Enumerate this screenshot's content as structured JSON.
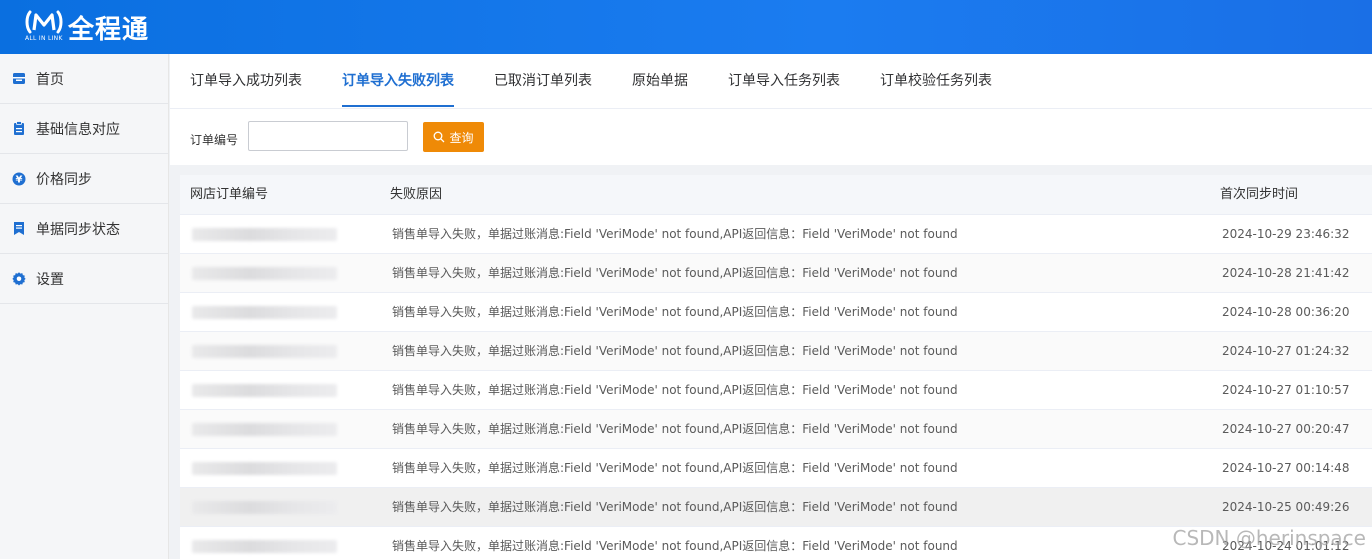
{
  "app": {
    "logo_text": "全程通",
    "logo_subtext": "ALL IN LINK"
  },
  "sidebar": {
    "items": [
      {
        "label": "首页",
        "icon": "inbox-icon"
      },
      {
        "label": "基础信息对应",
        "icon": "clipboard-icon"
      },
      {
        "label": "价格同步",
        "icon": "yen-icon"
      },
      {
        "label": "单据同步状态",
        "icon": "bookmark-icon"
      },
      {
        "label": "设置",
        "icon": "gear-icon"
      }
    ]
  },
  "tabs": [
    {
      "label": "订单导入成功列表",
      "active": false
    },
    {
      "label": "订单导入失败列表",
      "active": true
    },
    {
      "label": "已取消订单列表",
      "active": false
    },
    {
      "label": "原始单据",
      "active": false
    },
    {
      "label": "订单导入任务列表",
      "active": false
    },
    {
      "label": "订单校验任务列表",
      "active": false
    }
  ],
  "filter": {
    "order_no_label": "订单编号",
    "order_no_value": "",
    "search_label": "查询"
  },
  "table": {
    "columns": [
      "网店订单编号",
      "失败原因",
      "首次同步时间"
    ],
    "rows": [
      {
        "reason": "销售单导入失败，单据过账消息:Field 'VeriMode' not found,API返回信息：Field 'VeriMode' not found",
        "time": "2024-10-29 23:46:32"
      },
      {
        "reason": "销售单导入失败，单据过账消息:Field 'VeriMode' not found,API返回信息：Field 'VeriMode' not found",
        "time": "2024-10-28 21:41:42"
      },
      {
        "reason": "销售单导入失败，单据过账消息:Field 'VeriMode' not found,API返回信息：Field 'VeriMode' not found",
        "time": "2024-10-28 00:36:20"
      },
      {
        "reason": "销售单导入失败，单据过账消息:Field 'VeriMode' not found,API返回信息：Field 'VeriMode' not found",
        "time": "2024-10-27 01:24:32"
      },
      {
        "reason": "销售单导入失败，单据过账消息:Field 'VeriMode' not found,API返回信息：Field 'VeriMode' not found",
        "time": "2024-10-27 01:10:57"
      },
      {
        "reason": "销售单导入失败，单据过账消息:Field 'VeriMode' not found,API返回信息：Field 'VeriMode' not found",
        "time": "2024-10-27 00:20:47"
      },
      {
        "reason": "销售单导入失败，单据过账消息:Field 'VeriMode' not found,API返回信息：Field 'VeriMode' not found",
        "time": "2024-10-27 00:14:48"
      },
      {
        "reason": "销售单导入失败，单据过账消息:Field 'VeriMode' not found,API返回信息：Field 'VeriMode' not found",
        "time": "2024-10-25 00:49:26"
      },
      {
        "reason": "销售单导入失败，单据过账消息:Field 'VeriMode' not found,API返回信息：Field 'VeriMode' not found",
        "time": "2024-10-24 01:01:12"
      }
    ]
  },
  "watermark": "CSDN @herinspace",
  "colors": {
    "brand_blue": "#1f6fd1",
    "search_orange": "#ef8a07",
    "header_gradient_start": "#0a6fe0"
  }
}
